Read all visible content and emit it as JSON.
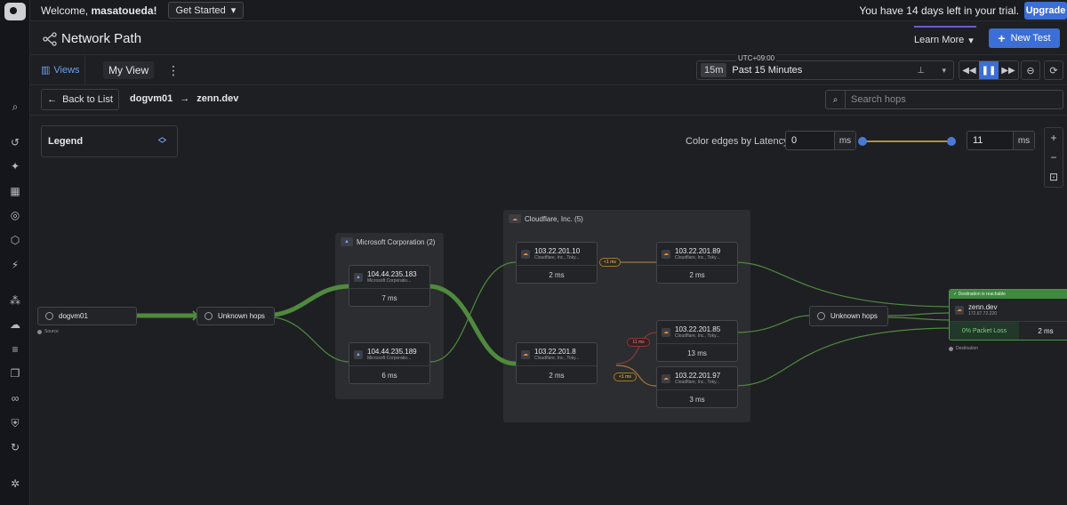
{
  "topbar": {
    "welcome_prefix": "Welcome,",
    "username": "masatoueda!",
    "get_started": "Get Started",
    "trial": "You have 14 days left in your trial.",
    "upgrade": "Upgrade"
  },
  "header": {
    "title": "Network Path",
    "learn_more": "Learn More",
    "new_test": "New Test"
  },
  "toolbar": {
    "views": "Views",
    "my_view": "My View",
    "tz": "UTC+09:00",
    "range_short": "15m",
    "range_label": "Past 15 Minutes"
  },
  "nav_bar": {
    "back": "Back to List",
    "source": "dogvm01",
    "destination": "zenn.dev",
    "search_placeholder": "Search hops"
  },
  "canvas": {
    "legend": "Legend",
    "latency_label": "Color edges by Latency",
    "latency_min": "0",
    "latency_max": "11",
    "unit": "ms",
    "groups": {
      "microsoft": "Microsoft Corporation (2)",
      "cloudflare": "Cloudflare, Inc. (5)"
    },
    "source_node": {
      "name": "dogvm01",
      "caption": "Source"
    },
    "unknown_1": "Unknown hops",
    "unknown_2": "Unknown hops",
    "hops": [
      {
        "ip": "104.44.235.183",
        "org": "Microsoft Corporatio...",
        "ms": "7 ms"
      },
      {
        "ip": "104.44.235.189",
        "org": "Microsoft Corporatio...",
        "ms": "6 ms"
      },
      {
        "ip": "103.22.201.10",
        "org": "Cloudflare, Inc., Toky...",
        "ms": "2 ms"
      },
      {
        "ip": "103.22.201.8",
        "org": "Cloudflare, Inc., Toky...",
        "ms": "2 ms"
      },
      {
        "ip": "103.22.201.89",
        "org": "Cloudflare, Inc., Toky...",
        "ms": "2 ms"
      },
      {
        "ip": "103.22.201.85",
        "org": "Cloudflare, Inc., Toky...",
        "ms": "13 ms"
      },
      {
        "ip": "103.22.201.97",
        "org": "Cloudflare, Inc., Toky...",
        "ms": "3 ms"
      }
    ],
    "edge_labels": {
      "e1": "<1 ms",
      "e2": "11 ms",
      "e3": "<1 ms"
    },
    "destination": {
      "status": "Destination is reachable",
      "host": "zenn.dev",
      "ip": "172.67.72.220",
      "loss": "0% Packet Loss",
      "latency": "2 ms",
      "caption": "Destination"
    },
    "colors": {
      "edge_green": "#4f8a3e",
      "edge_red": "#8a3838",
      "edge_orange": "#a07a35",
      "accent": "#3b6ed6"
    }
  }
}
